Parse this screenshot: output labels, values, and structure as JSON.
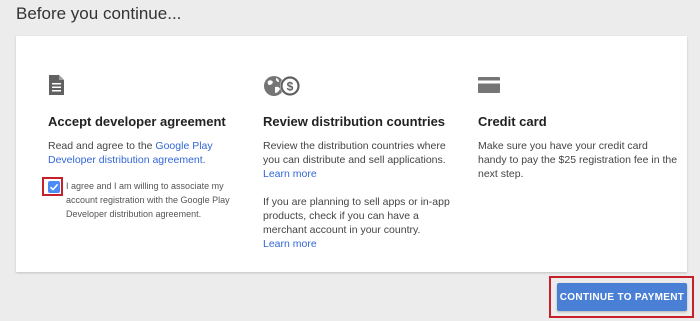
{
  "page": {
    "title": "Before you continue..."
  },
  "columns": [
    {
      "icon": "document-icon",
      "title": "Accept developer agreement",
      "body_prefix": "Read and agree to the ",
      "body_link": "Google Play Developer distribution agreement.",
      "checkbox_checked": true,
      "checkbox_label": "I agree and I am willing to associate my account registration with the Google Play Developer distribution agreement."
    },
    {
      "icon": "globe-dollar-icon",
      "title": "Review distribution countries",
      "para1": "Review the distribution countries where you can distribute and sell applications.",
      "link1": "Learn more",
      "para2": "If you are planning to sell apps or in-app products, check if you can have a merchant account in your country.",
      "link2": "Learn more"
    },
    {
      "icon": "credit-card-icon",
      "title": "Credit card",
      "body": "Make sure you have your credit card handy to pay the $25 registration fee in the next step."
    }
  ],
  "actions": {
    "continue_label": "CONTINUE TO PAYMENT"
  },
  "colors": {
    "accent": "#4a7fd6",
    "link": "#3367d6",
    "highlight": "#c8202a"
  }
}
